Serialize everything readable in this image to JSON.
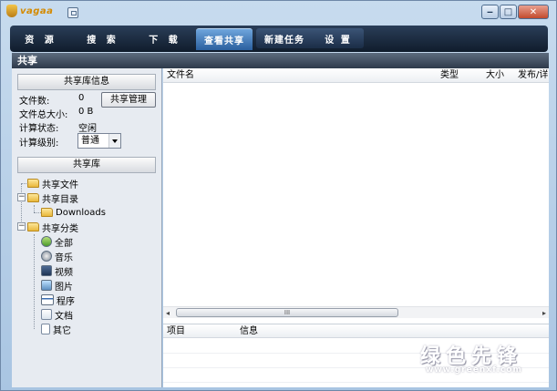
{
  "app": {
    "logo_text": "vagaa"
  },
  "toolbar": {
    "tabs": [
      "资 源",
      "搜 索",
      "下 载",
      "查看共享"
    ],
    "tabs2": [
      "新建任务",
      "设 置"
    ]
  },
  "section": {
    "title": "共享"
  },
  "share_info": {
    "header": "共享库信息",
    "file_count_label": "文件数:",
    "file_count": "0",
    "total_size_label": "文件总大小:",
    "total_size": "0 B",
    "calc_status_label": "计算状态:",
    "calc_status": "空闲",
    "calc_level_label": "计算级别:",
    "calc_level": "普通",
    "manage_button": "共享管理"
  },
  "library": {
    "header": "共享库",
    "tree": {
      "shared_files": "共享文件",
      "shared_dirs": "共享目录",
      "downloads": "Downloads",
      "categories": "共享分类",
      "cat_items": [
        "全部",
        "音乐",
        "视频",
        "图片",
        "程序",
        "文档",
        "其它"
      ]
    }
  },
  "file_table": {
    "columns": [
      "文件名",
      "类型",
      "大小",
      "发布/详"
    ]
  },
  "info_table": {
    "columns": [
      "项目",
      "信息"
    ]
  },
  "scrollbar": {
    "thumb_grip": "III"
  },
  "watermark": {
    "cn": "绿色先锋",
    "url": "www.greenxf.com"
  }
}
